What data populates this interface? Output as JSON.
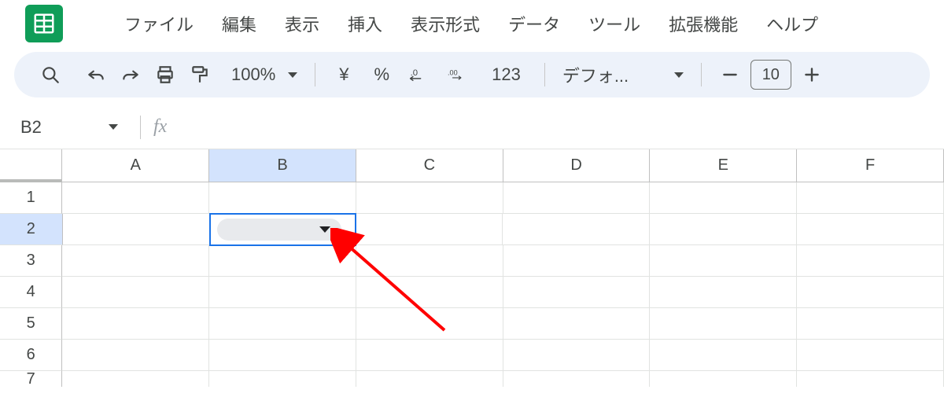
{
  "menus": {
    "file": "ファイル",
    "edit": "編集",
    "view": "表示",
    "insert": "挿入",
    "format": "表示形式",
    "data": "データ",
    "tools": "ツール",
    "extensions": "拡張機能",
    "help": "ヘルプ"
  },
  "toolbar": {
    "zoom": "100%",
    "currency": "¥",
    "percent": "%",
    "dec_decimal": ".0",
    "inc_decimal": ".00",
    "more_formats": "123",
    "font_name": "デフォ...",
    "font_size": "10"
  },
  "formula": {
    "name_box": "B2",
    "fx_label": "fx"
  },
  "columns": [
    "A",
    "B",
    "C",
    "D",
    "E",
    "F"
  ],
  "rows": [
    "1",
    "2",
    "3",
    "4",
    "5",
    "6",
    "7"
  ],
  "active": {
    "col": "B",
    "row": "2"
  }
}
